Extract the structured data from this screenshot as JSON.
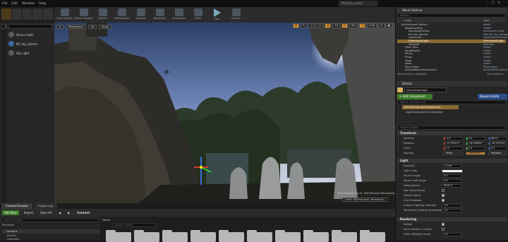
{
  "menu": [
    "File",
    "Edit",
    "Window",
    "Help"
  ],
  "project_title": "MyFirst_project",
  "modes_panel": {
    "search_placeholder": "Sky",
    "items": [
      {
        "label": "Atmos Light",
        "icon": "light-icon"
      },
      {
        "label": "BP_Sky_Sphere",
        "icon": "sphere-icon"
      },
      {
        "label": "Sky Light",
        "icon": "skylight-icon"
      }
    ]
  },
  "toolbar": {
    "buttons": [
      {
        "label": "Save Current",
        "name": "save-current"
      },
      {
        "label": "Source Control",
        "name": "source-control"
      },
      {
        "label": "Content",
        "name": "content"
      },
      {
        "label": "Marketplace",
        "name": "marketplace"
      },
      {
        "label": "Settings",
        "name": "settings"
      },
      {
        "label": "Blueprints",
        "name": "blueprints"
      },
      {
        "label": "Cinematics",
        "name": "cinematics"
      },
      {
        "label": "Build",
        "name": "build"
      },
      {
        "label": "Play",
        "name": "play"
      },
      {
        "label": "Launch",
        "name": "launch"
      }
    ]
  },
  "viewport": {
    "view_mode": "Perspective",
    "lit": "Lit",
    "show": "Show",
    "grid_snap": "10",
    "rot_snap": "10°",
    "scale_snap": "0.25",
    "cam_speed": "4",
    "info_line1": "Selected Actor(s) in:  MyFirstLevel (Persistent)",
    "level_label": "Level:  MyFirstLevel (Persistent)"
  },
  "world_outliner": {
    "title": "World Outliner",
    "search_placeholder": "Search...",
    "col_label": "Label",
    "col_type": "Type",
    "rows": [
      {
        "indent": 0,
        "label": "MyFirstLevel (Editor)",
        "type": "World",
        "selected": false
      },
      {
        "indent": 1,
        "label": "WorldLighting",
        "type": "Folder",
        "selected": false
      },
      {
        "indent": 2,
        "label": "AtmosphericFog",
        "type": "AtmosphericFog",
        "selected": false
      },
      {
        "indent": 2,
        "label": "BP_Sky_Sphere",
        "type": "Edit BP_Sky_Sphere",
        "selected": false
      },
      {
        "indent": 2,
        "label": "Lightmass...",
        "type": "LightmassImportanceVolume",
        "selected": false
      },
      {
        "indent": 2,
        "label": "DirectionalLight",
        "type": "DirectionalLight",
        "selected": true
      },
      {
        "indent": 2,
        "label": "SkyLight",
        "type": "SkyLight",
        "selected": false
      },
      {
        "indent": 1,
        "label": "Floor Tiles",
        "type": "Folder",
        "selected": false
      },
      {
        "indent": 1,
        "label": "LargeRocks",
        "type": "Folder",
        "selected": false
      },
      {
        "indent": 1,
        "label": "Plants",
        "type": "Folder",
        "selected": false
      },
      {
        "indent": 1,
        "label": "Props",
        "type": "Folder",
        "selected": false
      },
      {
        "indent": 1,
        "label": "Trees",
        "type": "Folder",
        "selected": false
      },
      {
        "indent": 1,
        "label": "Walls",
        "type": "Folder",
        "selected": false
      },
      {
        "indent": 1,
        "label": "PlayerStart",
        "type": "PlayerStart",
        "selected": false
      },
      {
        "indent": 1,
        "label": "SphereReflectionCapture",
        "type": "SphereReflectionCapture",
        "selected": false
      }
    ],
    "footer": "584 actors (1 selected)",
    "view_options": "View Options"
  },
  "details": {
    "title": "Details",
    "actor_name": "DirectionalLight",
    "add_component": "+ Add Component",
    "blueprint_button": "Blueprint/Add Script",
    "search_components": "Search Components",
    "component_root": "DirectionalLight1(Instance)",
    "component_child": "LightComponent (Inherited)",
    "search_details": "Search Details",
    "transform_header": "Transform",
    "location_label": "Location",
    "location": [
      "-0.0",
      "0.0",
      "380.0"
    ],
    "rotation_label": "Rotation",
    "rotation": [
      "-10.999023",
      "-18.999893",
      "-36.307026"
    ],
    "scale_label": "Scale",
    "scale": [
      "2.5",
      "2.5",
      "2.5"
    ],
    "mobility_label": "Mobility",
    "mobility_options": [
      "Static",
      "Stationary",
      "Movable"
    ],
    "light_header": "Light",
    "intensity_label": "Intensity",
    "intensity": "7.0 lux",
    "light_color_label": "Light Color",
    "source_angle_label": "Source Angle",
    "source_angle": "0.5",
    "source_soft_angle_label": "Source Soft Angle",
    "source_soft_angle": "0.0",
    "temperature_label": "Temperature",
    "temperature": "6500.0",
    "use_temperature_label": "Use Temperature",
    "affects_world_label": "Affects World",
    "cast_shadows_label": "Cast Shadows",
    "indirect_label": "Indirect Lighting Intensity",
    "indirect": "1.0",
    "volumetric_label": "Volumetric Scattering Intensity",
    "volumetric": "1.0",
    "rendering_header": "Rendering",
    "visible_label": "Visible",
    "hidden_in_game_label": "Actor Hidden In Game",
    "billboard_label": "Editor Billboard Scale",
    "billboard": "1.0"
  },
  "content_browser": {
    "tabs": [
      "Content Browser",
      "Output Log"
    ],
    "add_new": "Add New",
    "import": "Import",
    "save_all": "Save All",
    "path": "Content",
    "search_folders": "Search Folders",
    "favorites": "Favorites",
    "tree_root": "Content",
    "tree_items": [
      "Archviz",
      "Geometry"
    ],
    "filters": "Filters",
    "search_assets": "Search Assets"
  }
}
